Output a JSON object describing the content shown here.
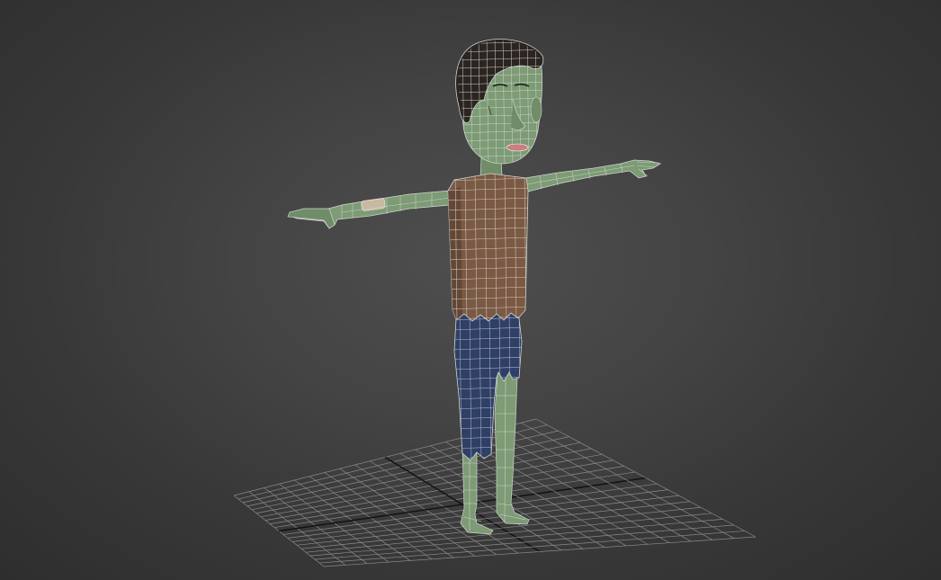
{
  "viewport": {
    "shading": "shaded-with-wireframe",
    "background_color": "#444444",
    "grid_color": "#8a8a8a",
    "grid_axis_color": "#111111"
  },
  "model": {
    "pose": "T-pose",
    "colors": {
      "skin": "#7d9b74",
      "skin_dark": "#5c7a55",
      "shirt": "#7a5a44",
      "shirt_dark": "#5e4434",
      "pants": "#2f3f66",
      "hair": "#2b2420",
      "lips": "#c97f7f",
      "wire": "#cfd6d0",
      "bandage": "#c9b9a2"
    }
  }
}
